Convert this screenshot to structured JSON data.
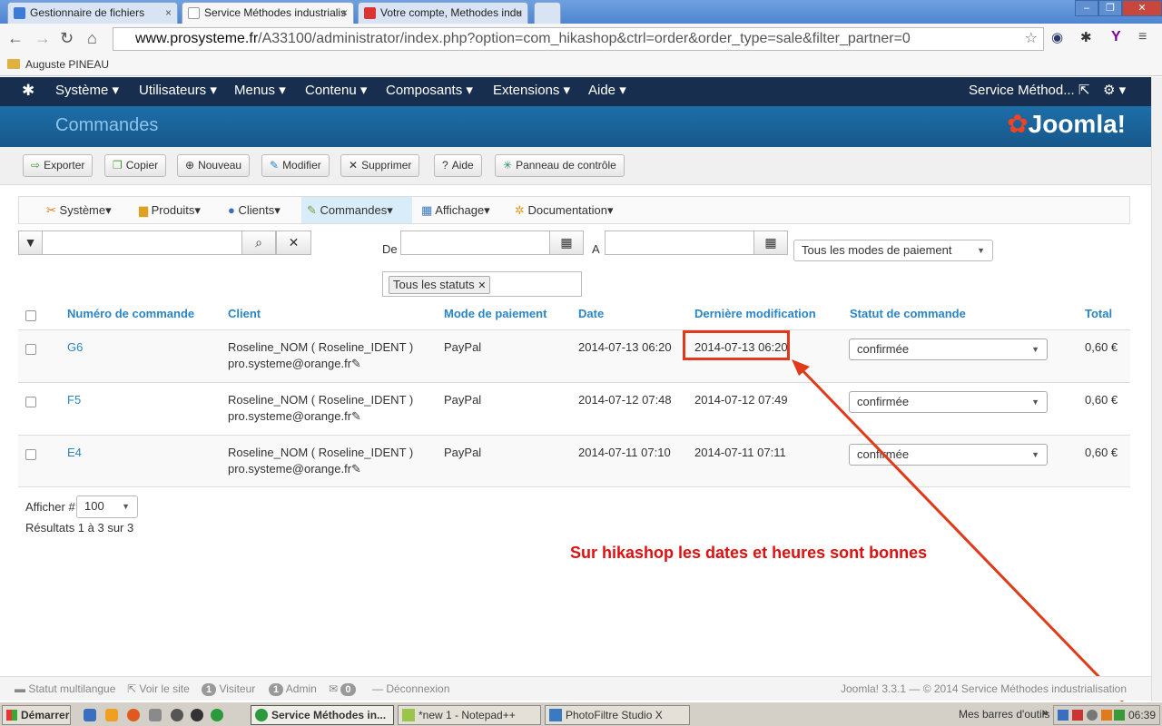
{
  "browser": {
    "tabs": [
      {
        "label": "Gestionnaire de fichiers"
      },
      {
        "label": "Service Méthodes industrialis"
      },
      {
        "label": "Votre compte, Methodes indu"
      }
    ],
    "url_host": "www.prosysteme.fr",
    "url_path": "/A33100/administrator/index.php?option=com_hikashop&ctrl=order&order_type=sale&filter_partner=0",
    "bookmark": "Auguste PINEAU"
  },
  "joomla_nav": {
    "items": [
      "Système",
      "Utilisateurs",
      "Menus",
      "Contenu",
      "Composants",
      "Extensions",
      "Aide"
    ],
    "site_link": "Service Méthod..."
  },
  "header": {
    "title": "Commandes",
    "logo": "Joomla!"
  },
  "toolbar": {
    "buttons": [
      "Exporter",
      "Copier",
      "Nouveau",
      "Modifier",
      "Supprimer",
      "Aide",
      "Panneau de contrôle"
    ]
  },
  "submenu": {
    "items": [
      "Système",
      "Produits",
      "Clients",
      "Commandes",
      "Affichage",
      "Documentation"
    ]
  },
  "filters": {
    "from_label": "De",
    "to_label": "A",
    "payment_select": "Tous les modes de paiement",
    "status_chip": "Tous les statuts"
  },
  "table": {
    "headers": [
      "Numéro de commande",
      "Client",
      "Mode de paiement",
      "Date",
      "Dernière modification",
      "Statut de commande",
      "Total"
    ],
    "rows": [
      {
        "num": "G6",
        "client": "Roseline_NOM ( Roseline_IDENT )",
        "email": "pro.systeme@orange.fr",
        "payment": "PayPal",
        "date": "2014-07-13 06:20",
        "modified": "2014-07-13 06:20",
        "status": "confirmée",
        "total": "0,60 €"
      },
      {
        "num": "F5",
        "client": "Roseline_NOM ( Roseline_IDENT )",
        "email": "pro.systeme@orange.fr",
        "payment": "PayPal",
        "date": "2014-07-12 07:48",
        "modified": "2014-07-12 07:49",
        "status": "confirmée",
        "total": "0,60 €"
      },
      {
        "num": "E4",
        "client": "Roseline_NOM ( Roseline_IDENT )",
        "email": "pro.systeme@orange.fr",
        "payment": "PayPal",
        "date": "2014-07-11 07:10",
        "modified": "2014-07-11 07:11",
        "status": "confirmée",
        "total": "0,60 €"
      }
    ]
  },
  "pagination": {
    "label": "Afficher #",
    "value": "100",
    "results": "Résultats 1 à 3 sur 3"
  },
  "annotation": "Sur hikashop les dates et heures sont bonnes",
  "footer": {
    "multilang": "Statut multilangue",
    "view_site": "Voir le site",
    "visitor_count": "1",
    "visitor_label": "Visiteur",
    "admin_count": "1",
    "admin_label": "Admin",
    "msg_count": "0",
    "logout": "Déconnexion",
    "copyright": "Joomla! 3.3.1 — © 2014 Service Méthodes industrialisation"
  },
  "taskbar": {
    "start": "Démarrer",
    "tasks": [
      "Service Méthodes in...",
      "*new  1 - Notepad++",
      "PhotoFiltre Studio X"
    ],
    "toolbars": "Mes barres d'outils",
    "clock": "06:39"
  },
  "colors": {
    "accent": "#2a85c4",
    "nav": "#182e4e",
    "header": "#1d6ea8",
    "annotation": "#e01010"
  }
}
